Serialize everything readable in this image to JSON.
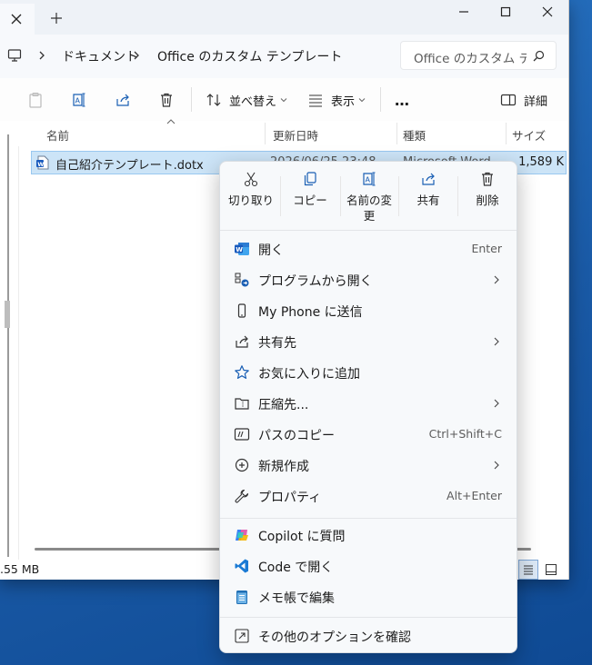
{
  "window": {
    "close_glyph": "×",
    "newtab_glyph": "+"
  },
  "address": {
    "crumbs": [
      "ドキュメント",
      "Office のカスタム テンプレート"
    ],
    "search_placeholder": "Office のカスタム テ"
  },
  "toolbar": {
    "sort_label": "並べ替え",
    "view_label": "表示",
    "more_label": "…",
    "details_label": "詳細"
  },
  "columns": {
    "name": "名前",
    "date": "更新日時",
    "type": "種類",
    "size": "サイズ"
  },
  "files": [
    {
      "name": "自己紹介テンプレート.dotx",
      "date": "2026/06/25 23:48",
      "type": "Microsoft Word",
      "size": "1,589 K"
    }
  ],
  "status": {
    "text": ".55 MB"
  },
  "context_menu": {
    "quick_actions": [
      {
        "label": "切り取り",
        "icon": "scissors-icon"
      },
      {
        "label": "コピー",
        "icon": "copy-icon"
      },
      {
        "label": "名前の変更",
        "icon": "rename-icon"
      },
      {
        "label": "共有",
        "icon": "share-icon"
      },
      {
        "label": "削除",
        "icon": "trash-icon"
      }
    ],
    "items": [
      {
        "label": "開く",
        "shortcut": "Enter",
        "icon": "word-icon"
      },
      {
        "label": "プログラムから開く",
        "shortcut": "",
        "icon": "open-with-icon",
        "submenu": true
      },
      {
        "label": "My Phone に送信",
        "shortcut": "",
        "icon": "phone-icon"
      },
      {
        "label": "共有先",
        "shortcut": "",
        "icon": "share-icon",
        "submenu": true
      },
      {
        "label": "お気に入りに追加",
        "shortcut": "",
        "icon": "star-icon"
      },
      {
        "label": "圧縮先...",
        "shortcut": "",
        "icon": "zip-folder-icon",
        "submenu": true
      },
      {
        "label": "パスのコピー",
        "shortcut": "Ctrl+Shift+C",
        "icon": "copy-path-icon"
      },
      {
        "label": "新規作成",
        "shortcut": "",
        "icon": "plus-circle-icon",
        "submenu": true
      },
      {
        "label": "プロパティ",
        "shortcut": "Alt+Enter",
        "icon": "wrench-icon"
      },
      {
        "label": "Copilot に質問",
        "shortcut": "",
        "icon": "copilot-icon"
      },
      {
        "label": "Code で開く",
        "shortcut": "",
        "icon": "vscode-icon"
      },
      {
        "label": "メモ帳で編集",
        "shortcut": "",
        "icon": "notepad-icon"
      },
      {
        "label": "その他のオプションを確認",
        "shortcut": "",
        "icon": "more-options-icon"
      }
    ]
  }
}
